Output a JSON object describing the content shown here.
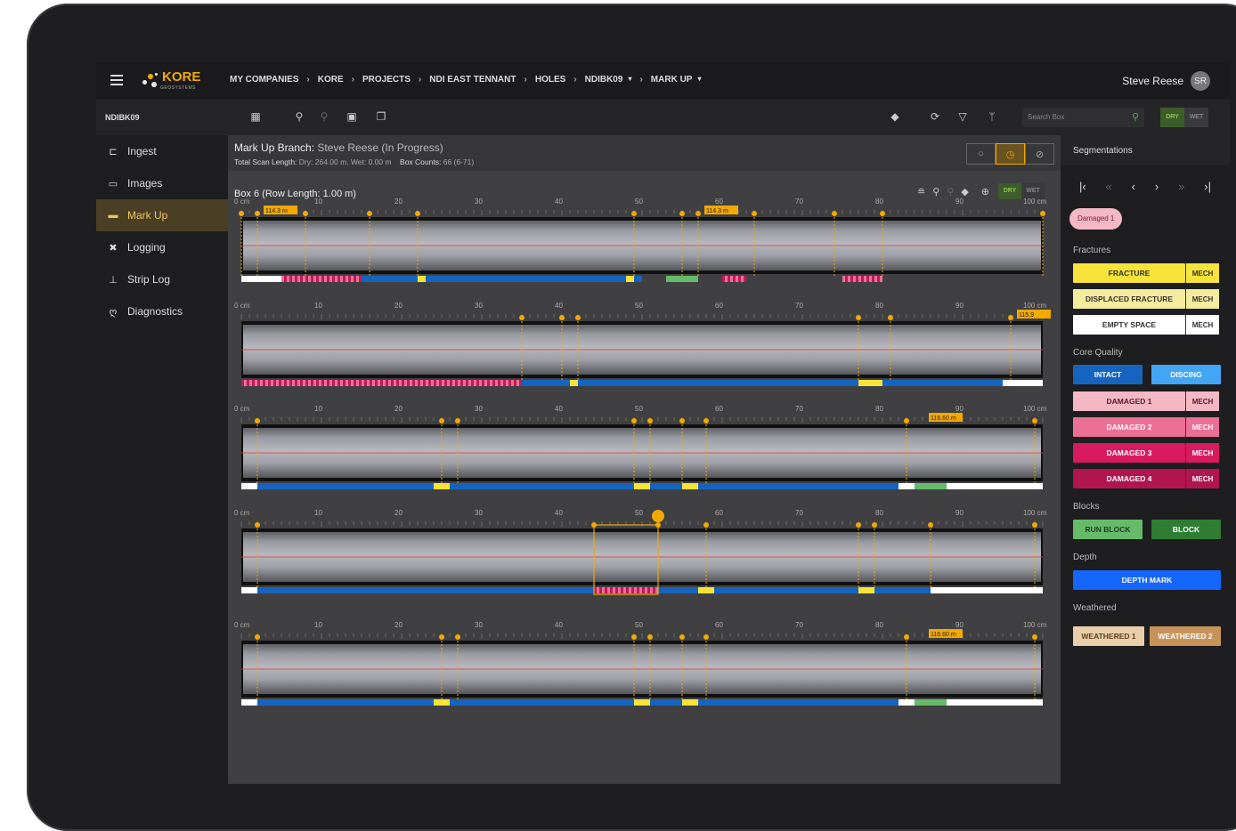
{
  "breadcrumbs": [
    "MY COMPANIES",
    "KORE",
    "PROJECTS",
    "NDI EAST TENNANT",
    "HOLES",
    "NDIBK09",
    "MARK UP"
  ],
  "logo": {
    "word": "KORE",
    "sub": "GEOSYSTEMS"
  },
  "user": {
    "name": "Steve Reese",
    "initials": "SR"
  },
  "hole_label": "NDIBK09",
  "search": {
    "placeholder": "Search Box"
  },
  "drywet": {
    "dry": "DRY",
    "wet": "WET"
  },
  "sidebar": [
    {
      "label": "Ingest",
      "icon": "crop-icon"
    },
    {
      "label": "Images",
      "icon": "images-icon"
    },
    {
      "label": "Mark Up",
      "icon": "markup-icon",
      "active": true
    },
    {
      "label": "Logging",
      "icon": "tools-icon"
    },
    {
      "label": "Strip Log",
      "icon": "chart-icon"
    },
    {
      "label": "Diagnostics",
      "icon": "stethoscope-icon"
    }
  ],
  "header": {
    "branch_label": "Mark Up Branch:",
    "branch_value": "Steve Reese  (In Progress)",
    "scan_label": "Total Scan Length:",
    "scan_value": "Dry: 264.00 m, Wet: 0.00 m",
    "box_label": "Box Counts:",
    "box_value": "66 (6-71)"
  },
  "box_title": "Box 6 (Row Length: 1.00 m)",
  "scale_labels": [
    "0 cm",
    "10",
    "20",
    "30",
    "40",
    "50",
    "60",
    "70",
    "80",
    "90",
    "100 cm"
  ],
  "depth_tags": {
    "r1a": "114.3 m",
    "r1b": "114.3 m",
    "r2": "115.9",
    "r3": "116.60 m",
    "r5": "116.60 m"
  },
  "right_panel": {
    "title": "Segmentations",
    "chip": "Damaged 1",
    "fractures_label": "Fractures",
    "fractures": [
      {
        "label": "FRACTURE",
        "mech": "MECH",
        "color": "#f7e33a"
      },
      {
        "label": "DISPLACED FRACTURE",
        "mech": "MECH",
        "color": "#f4ec9c"
      },
      {
        "label": "EMPTY SPACE",
        "mech": "MECH",
        "color": "#ffffff"
      }
    ],
    "core_quality_label": "Core Quality",
    "intact": "INTACT",
    "discing": "DISCING",
    "damaged": [
      {
        "label": "DAMAGED 1",
        "mech": "MECH",
        "color": "#f4b8c4"
      },
      {
        "label": "DAMAGED 2",
        "mech": "MECH",
        "color": "#ec6f96"
      },
      {
        "label": "DAMAGED 3",
        "mech": "MECH",
        "color": "#d81b60"
      },
      {
        "label": "DAMAGED 4",
        "mech": "MECH",
        "color": "#b0154f"
      }
    ],
    "blocks_label": "Blocks",
    "run_block": "RUN BLOCK",
    "block": "BLOCK",
    "depth_label": "Depth",
    "depth_mark": "DEPTH MARK",
    "weathered_label": "Weathered",
    "weathered1": "WEATHERED 1",
    "weathered2": "WEATHERED 2"
  }
}
